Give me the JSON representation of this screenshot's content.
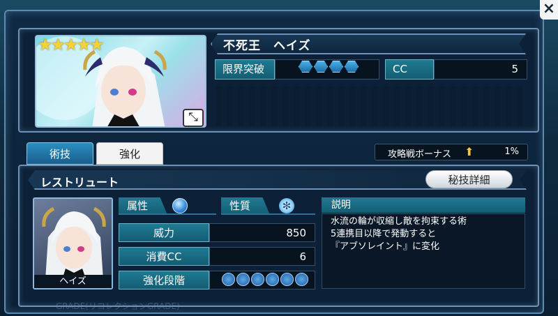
{
  "header": {
    "close_icon": "×"
  },
  "character": {
    "rarity_stars": "★★★★★",
    "rarity": 5,
    "name": "不死王　ヘイズ",
    "limit_break_label": "限界突破",
    "limit_break_level": 4,
    "cc_label": "CC",
    "cc_value": "5",
    "expand_icon": "⤡"
  },
  "tabs": [
    {
      "label": "術技"
    },
    {
      "label": "強化"
    }
  ],
  "bonus": {
    "label": "攻略戦ボーナス",
    "icon": "up-arrow-icon",
    "value": "1%"
  },
  "skill": {
    "name": "レストリュート",
    "secret_button": "秘技詳細",
    "thumb_name": "ヘイズ",
    "attribute_label": "属性",
    "attribute_icon": "water-icon",
    "nature_label": "性質",
    "nature_icon": "snowflake-icon",
    "power_label": "威力",
    "power_value": "850",
    "cost_label": "消費CC",
    "cost_value": "6",
    "enhance_label": "強化段階",
    "enhance_level": 6,
    "description_label": "説明",
    "description_lines": [
      "水流の輪が収縮し敵を拘束する術",
      "5連携目以降で発動すると",
      "『アブソレイント』に変化"
    ]
  },
  "watermark": "GRADE(リコレクションGRADE)",
  "colors": {
    "accent": "#1e7a92",
    "frame": "#6f93b8",
    "gold": "#f5d13a"
  }
}
